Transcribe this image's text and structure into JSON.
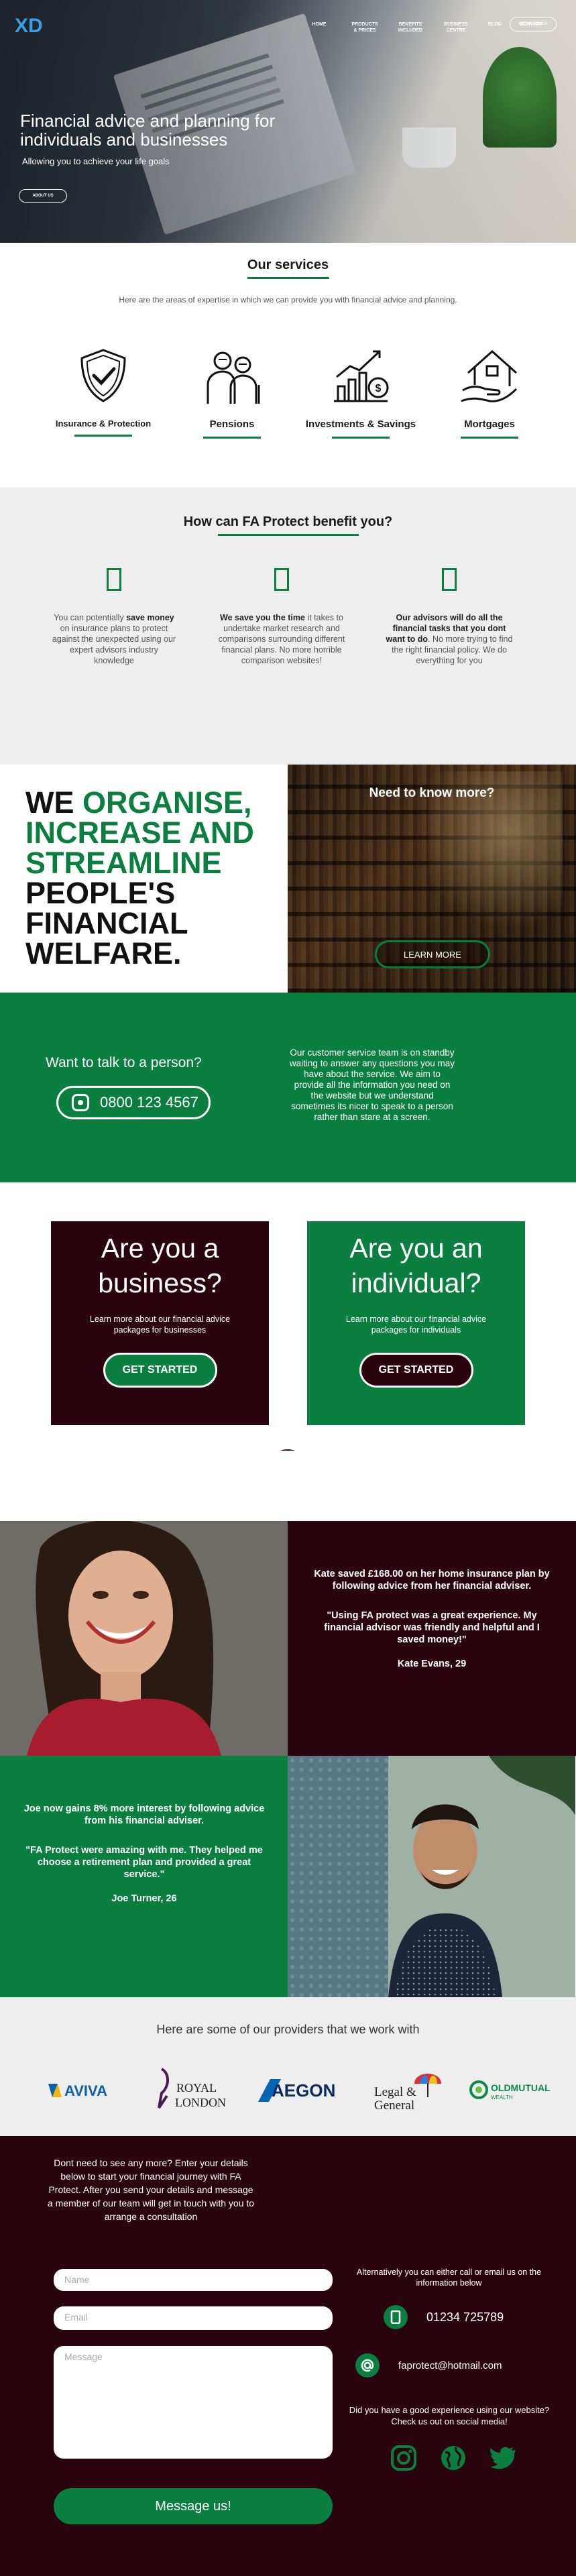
{
  "header": {
    "logo": "XD",
    "nav": [
      "HOME",
      "PRODUCTS & PRICES",
      "BENEFITS INCLUDED",
      "BUSINESS CENTRE",
      "BLOG",
      "CONTACT"
    ],
    "cta": "GET IN TOUCH"
  },
  "hero": {
    "title": "Financial advice and planning for individuals and businesses",
    "subtitle": "Allowing you to achieve your life goals",
    "button": "ABOUT US"
  },
  "services": {
    "title": "Our services",
    "intro": "Here are the areas of expertise in which we can provide you with financial advice and planning.",
    "items": [
      {
        "label": "Insurance & Protection",
        "icon": "shield-check-icon"
      },
      {
        "label": "Pensions",
        "icon": "elderly-couple-icon"
      },
      {
        "label": "Investments & Savings",
        "icon": "growth-chart-icon"
      },
      {
        "label": "Mortgages",
        "icon": "house-hand-icon"
      }
    ]
  },
  "benefit": {
    "title": "How can FA Protect benefit you?",
    "items": [
      {
        "pre": "You can potentially ",
        "bold": "save money",
        "post": " on insurance plans to protect against the unexpected using our expert advisors industry knowledge"
      },
      {
        "pre": "",
        "bold": "We save you the time",
        "post": " it takes to undertake market research and comparisons surrounding different financial plans. No more horrible comparison websites!"
      },
      {
        "pre": "",
        "bold": "Our advisors will do all the financial tasks that you dont want to do",
        "post": ". No more trying to find the right financial policy. We do everything for you"
      }
    ]
  },
  "organise": {
    "we": "WE ",
    "green": "ORGANISE, INCREASE AND STREAMLINE",
    "rest": " PEOPLE'S FINANCIAL WELFARE.",
    "panel_title": "Need to know more?",
    "panel_button": "LEARN MORE"
  },
  "talk": {
    "heading": "Want to talk to a person?",
    "phone": "0800 123 4567",
    "text": "Our customer service team is on standby waiting to answer any questions you may have about the service. We aim to provide all the information you need on the website but we understand sometimes its nicer to speak to a person rather than stare at a screen."
  },
  "cards": [
    {
      "title": "Are you a business?",
      "desc": "Learn more about our financial advice packages for businesses",
      "button": "GET STARTED"
    },
    {
      "title": "Are you an individual?",
      "desc": "Learn more about our financial advice packages for individuals",
      "button": "GET STARTED"
    }
  ],
  "testimonials": [
    {
      "summary": "Kate saved £168.00 on her home insurance plan by following advice from her financial adviser.",
      "quote": "\"Using FA protect was a great experience. My financial advisor was friendly and helpful and I saved money!\"",
      "name": "Kate Evans, 29"
    },
    {
      "summary": "Joe now gains 8% more interest by following advice from his financial adviser.",
      "quote": "\"FA Protect were amazing with me. They helped me choose a retirement plan and provided a great service.\"",
      "name": "Joe Turner, 26"
    }
  ],
  "providers": {
    "title": "Here are some of our providers that we work with",
    "logos": [
      "AVIVA",
      "ROYAL LONDON",
      "AEGON",
      "Legal & General",
      "OLDMUTUAL WEALTH"
    ]
  },
  "contact": {
    "intro": "Dont need to see any more? Enter your details below to start your financial journey with FA Protect. After you send your details and message a member of our team will get in touch with you to arrange a consultation",
    "name_placeholder": "Name",
    "email_placeholder": "Email",
    "message_placeholder": "Message",
    "send": "Message us!",
    "alt": "Alternatively you can either call or email us on the information below",
    "phone": "01234 725789",
    "email": "faprotect@hotmail.com",
    "social_text": "Did you have a good experience using our website? Check us out on social media!"
  },
  "colors": {
    "green": "#0b7f3f",
    "maroon": "#2a0510",
    "logo_blue": "#3aa0e6"
  }
}
